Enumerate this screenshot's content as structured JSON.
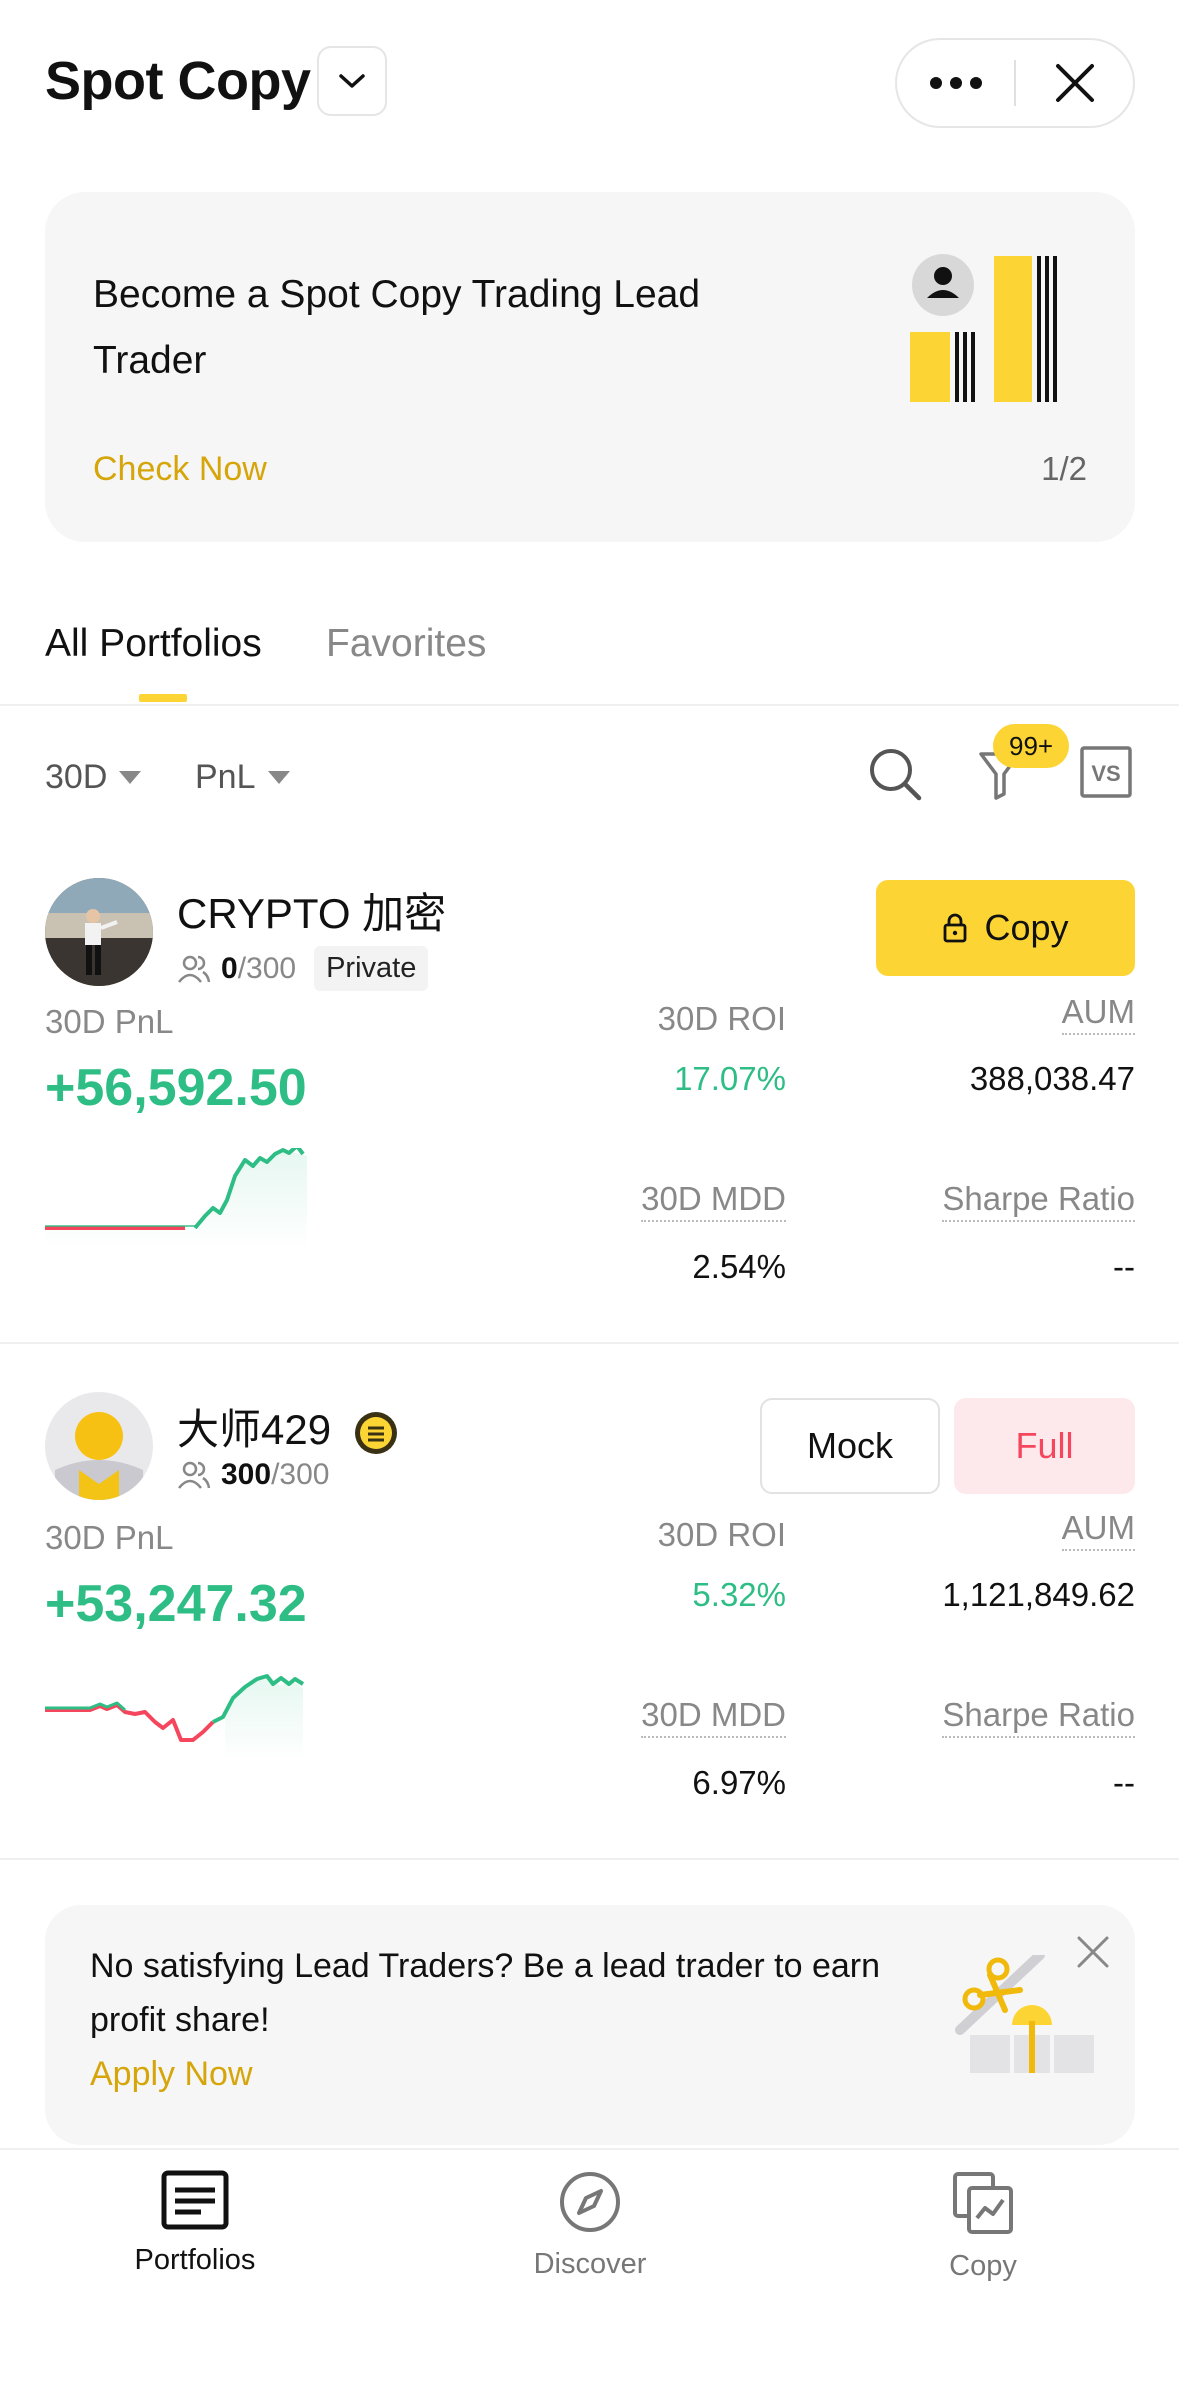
{
  "header": {
    "title": "Spot Copy"
  },
  "banner": {
    "text": "Become a Spot Copy Trading Lead Trader",
    "link": "Check Now",
    "page": "1/2"
  },
  "tabs": [
    {
      "label": "All Portfolios",
      "active": true
    },
    {
      "label": "Favorites",
      "active": false
    }
  ],
  "filters": {
    "period": "30D",
    "sort": "PnL",
    "filter_badge": "99+",
    "compare_label": "VS"
  },
  "traders": [
    {
      "name": "CRYPTO 加密",
      "followers": "0",
      "followers_max": "/300",
      "tag": "Private",
      "action": "Copy",
      "pnl_label": "30D PnL",
      "pnl": "+56,592.50",
      "roi_label": "30D  ROI",
      "roi": "17.07%",
      "aum_label": "AUM",
      "aum": "388,038.47",
      "mdd_label": "30D MDD",
      "mdd": "2.54%",
      "sharpe_label": "Sharpe Ratio",
      "sharpe": "--"
    },
    {
      "name": "大师429",
      "followers": "300",
      "followers_max": "/300",
      "mock_label": "Mock",
      "full_label": "Full",
      "pnl_label": "30D PnL",
      "pnl": "+53,247.32",
      "roi_label": "30D  ROI",
      "roi": "5.32%",
      "aum_label": "AUM",
      "aum": "1,121,849.62",
      "mdd_label": "30D MDD",
      "mdd": "6.97%",
      "sharpe_label": "Sharpe Ratio",
      "sharpe": "--"
    }
  ],
  "promo": {
    "text": "No satisfying Lead Traders? Be a lead trader to earn profit share!",
    "link": "Apply Now"
  },
  "bottom_nav": [
    {
      "label": "Portfolios",
      "active": true
    },
    {
      "label": "Discover",
      "active": false
    },
    {
      "label": "Copy",
      "active": false
    }
  ],
  "colors": {
    "brand_yellow": "#fcd535",
    "link_gold": "#d6a50a",
    "profit_green": "#2ebd85",
    "loss_red": "#f6465d"
  }
}
